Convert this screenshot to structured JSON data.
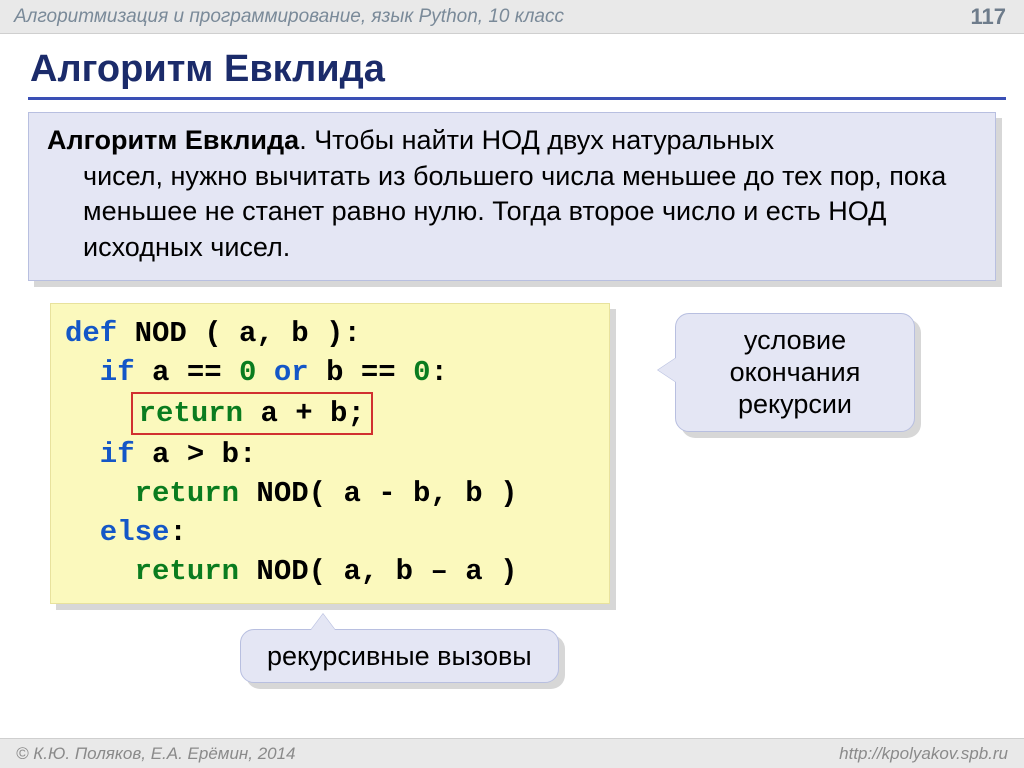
{
  "header": {
    "subject": "Алгоритмизация и программирование, язык Python, 10 класс",
    "page": "117"
  },
  "title": "Алгоритм Евклида",
  "definition": {
    "lead": "Алгоритм Евклида",
    "body1": ". Чтобы найти НОД двух натуральных",
    "body2": "чисел, нужно вычитать из большего числа меньшее до тех пор, пока меньшее не станет равно нулю. Тогда второе число и есть НОД исходных чисел."
  },
  "code": {
    "l1_def": "def",
    "l1_rest": " NOD ( a, b ):",
    "l2_if": "  if",
    "l2_a": " a",
    "l2_eq": " ==",
    "l2_zero": " 0",
    "l2_or": " or",
    "l2_b": " b",
    "l2_eq2": " ==",
    "l2_zero2": " 0",
    "l2_colon": ":",
    "l3_return": "return",
    "l3_expr": " a + b;",
    "l4_if": "  if",
    "l4_rest": " a > b:",
    "l5_return": "    return",
    "l5_rest": " NOD( a - b, b )",
    "l6_else": "  else",
    "l6_colon": ":",
    "l7_return": "    return",
    "l7_rest": " NOD( a, b – a )"
  },
  "callouts": {
    "c1_line1": "условие",
    "c1_line2": "окончания",
    "c1_line3": "рекурсии",
    "c2": "рекурсивные вызовы"
  },
  "footer": {
    "left": "© К.Ю. Поляков, Е.А. Ерёмин, 2014",
    "right": "http://kpolyakov.spb.ru"
  }
}
